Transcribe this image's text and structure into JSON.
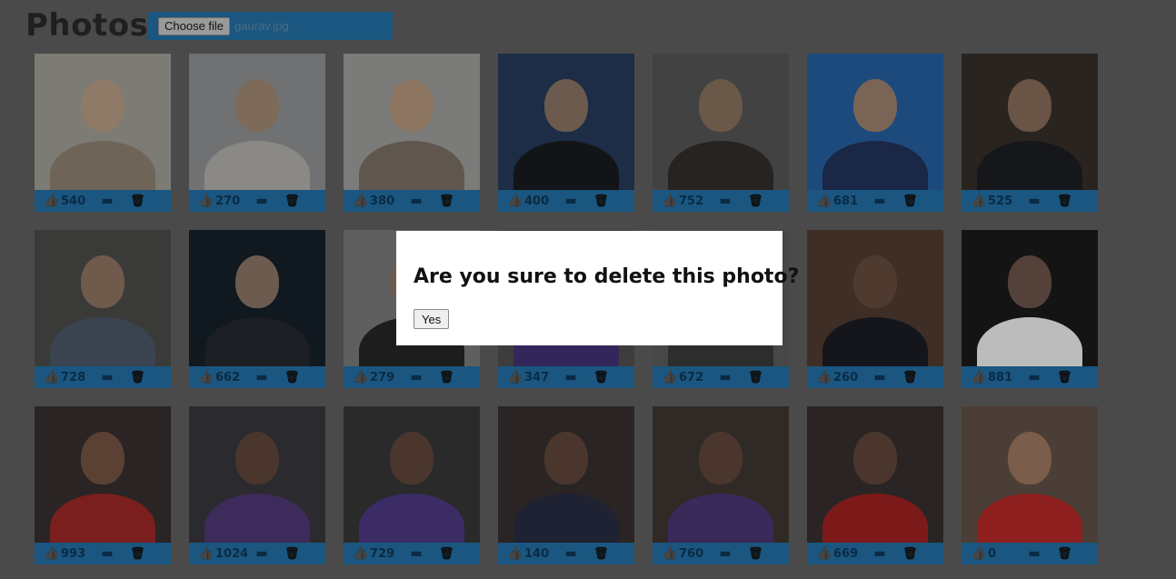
{
  "header": {
    "title": "Photos",
    "file_button_label": "Choose file",
    "file_name": "gaurav.jpg"
  },
  "icons": {
    "like": "thumbs-up-icon",
    "comment": "comment-icon",
    "delete": "trash-icon"
  },
  "colors": {
    "accent": "#1a5680",
    "overlay": "#4a4a4a",
    "modal_bg": "#ffffff"
  },
  "photos": [
    {
      "likes": "540",
      "bg": "#7c7b74",
      "skin": "#8e7a66",
      "shirt": "#6e6458"
    },
    {
      "likes": "270",
      "bg": "#6f7173",
      "skin": "#7e6a58",
      "shirt": "#8a8986"
    },
    {
      "likes": "380",
      "bg": "#7b7b7a",
      "skin": "#8e7762",
      "shirt": "#5f574d"
    },
    {
      "likes": "400",
      "bg": "#1c2d45",
      "skin": "#6c5a4e",
      "shirt": "#121417"
    },
    {
      "likes": "752",
      "bg": "#424242",
      "skin": "#6a5848",
      "shirt": "#262320"
    },
    {
      "likes": "681",
      "bg": "#1d4a7d",
      "skin": "#7a6456",
      "shirt": "#1a2746"
    },
    {
      "likes": "525",
      "bg": "#2a2420",
      "skin": "#6a5446",
      "shirt": "#16171a"
    },
    {
      "likes": "728",
      "bg": "#3a3a39",
      "skin": "#6f5a4c",
      "shirt": "#3a4350"
    },
    {
      "likes": "662",
      "bg": "#101820",
      "skin": "#6e5b4f",
      "shirt": "#1b1e22"
    },
    {
      "likes": "279",
      "bg": "#5f5f5f",
      "skin": "#6e5b4f",
      "shirt": "#1d1d1d"
    },
    {
      "likes": "347",
      "bg": "#3d3d3d",
      "skin": "#6e5b4f",
      "shirt": "#33265a"
    },
    {
      "likes": "672",
      "bg": "#474747",
      "skin": "#6e5b4f",
      "shirt": "#2d2d2d"
    },
    {
      "likes": "260",
      "bg": "#3f2e25",
      "skin": "#4f3a30",
      "shirt": "#14161c"
    },
    {
      "likes": "881",
      "bg": "#141414",
      "skin": "#54423a",
      "shirt": "#bcbcbc"
    },
    {
      "likes": "993",
      "bg": "#2a2424",
      "skin": "#5a4133",
      "shirt": "#7a1e1e"
    },
    {
      "likes": "1024",
      "bg": "#2b2a2e",
      "skin": "#4a362d",
      "shirt": "#3d2b5b"
    },
    {
      "likes": "729",
      "bg": "#2a2a2b",
      "skin": "#4a362d",
      "shirt": "#3b2c66"
    },
    {
      "likes": "140",
      "bg": "#2a2424",
      "skin": "#4a362d",
      "shirt": "#1e2233"
    },
    {
      "likes": "760",
      "bg": "#302a26",
      "skin": "#4a362d",
      "shirt": "#392a5a"
    },
    {
      "likes": "669",
      "bg": "#2a2424",
      "skin": "#4a362d",
      "shirt": "#7c1a1a"
    },
    {
      "likes": "0",
      "bg": "#4b3e37",
      "skin": "#7a5d4a",
      "shirt": "#8f2020"
    }
  ],
  "modal": {
    "message": "Are you sure to delete this photo?",
    "confirm_label": "Yes"
  }
}
